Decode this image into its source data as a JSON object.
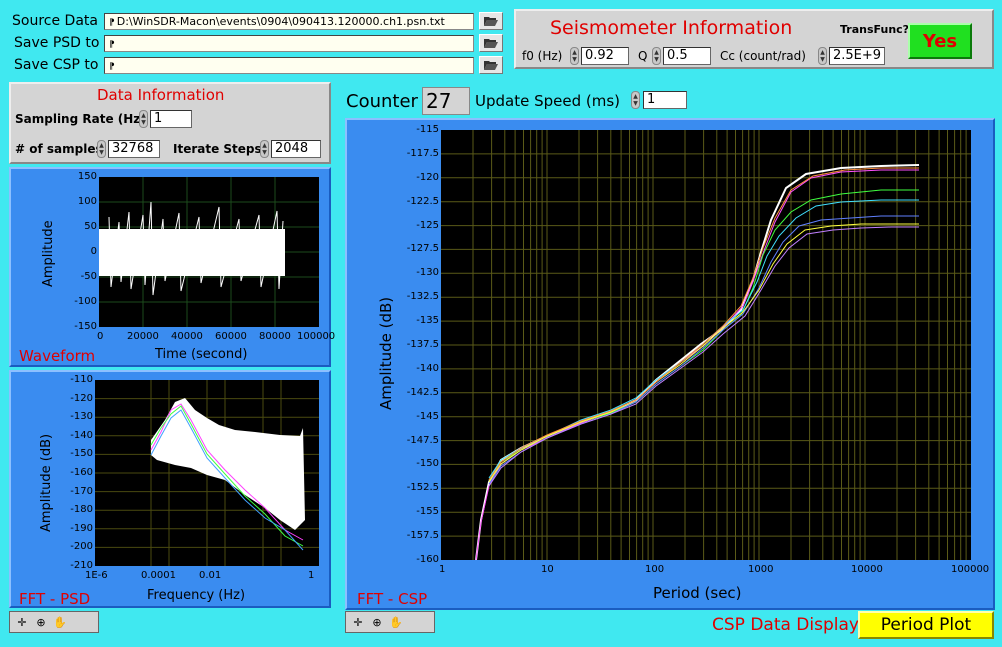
{
  "paths": {
    "source_label": "Source Data",
    "source_value": "D:\\WinSDR-Macon\\events\\0904\\090413.120000.ch1.psn.txt",
    "psd_label": "Save PSD to",
    "psd_value": "",
    "csp_label": "Save CSP to",
    "csp_value": ""
  },
  "seismometer": {
    "title": "Seismometer Information",
    "transfunc_label": "TransFunc?",
    "transfunc_value": "Yes",
    "f0_label": "f0 (Hz)",
    "f0_value": "0.92",
    "q_label": "Q",
    "q_value": "0.5",
    "cc_label": "Cc (count/rad)",
    "cc_value": "2.5E+9"
  },
  "data_info": {
    "title": "Data Information",
    "rate_label": "Sampling Rate (Hz)",
    "rate_value": "1",
    "samples_label": "# of samples",
    "samples_value": "32768",
    "iterate_label": "Iterate Steps",
    "iterate_value": "2048"
  },
  "counter": {
    "label": "Counter",
    "value": "27",
    "speed_label": "Update Speed (ms)",
    "speed_value": "1"
  },
  "waveform": {
    "title": "Waveform",
    "xlabel": "Time (second)",
    "ylabel": "Amplitude",
    "yticks": [
      "150",
      "100",
      "50",
      "0",
      "-50",
      "-100",
      "-150"
    ],
    "xticks": [
      "0",
      "20000",
      "40000",
      "60000",
      "80000",
      "100000"
    ]
  },
  "psd": {
    "title": "FFT - PSD",
    "xlabel": "Frequency (Hz)",
    "ylabel": "Amplitude (dB)",
    "yticks": [
      "-110",
      "-120",
      "-130",
      "-140",
      "-150",
      "-160",
      "-170",
      "-180",
      "-190",
      "-200",
      "-210"
    ],
    "xticks": [
      "1E-6",
      "0.0001",
      "0.01",
      "1"
    ]
  },
  "csp": {
    "title": "FFT - CSP",
    "xlabel": "Period (sec)",
    "ylabel": "Amplitude (dB)",
    "yticks": [
      "-115",
      "-117.5",
      "-120",
      "-122.5",
      "-125",
      "-127.5",
      "-130",
      "-132.5",
      "-135",
      "-137.5",
      "-140",
      "-142.5",
      "-145",
      "-147.5",
      "-150",
      "-152.5",
      "-155",
      "-157.5",
      "-160"
    ],
    "xticks": [
      "1",
      "10",
      "100",
      "1000",
      "10000",
      "100000"
    ]
  },
  "bottom": {
    "display_label": "CSP Data Display",
    "button_label": "Period Plot"
  },
  "colors": {
    "background": "#40e8f0",
    "graph_frame": "#3a8cf0",
    "title_red": "#e00000",
    "yes_green": "#20e020",
    "period_yellow": "#ffff00"
  }
}
